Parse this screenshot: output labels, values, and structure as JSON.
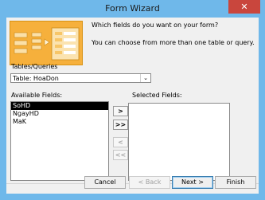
{
  "window": {
    "title": "Form Wizard",
    "close_label": "✕"
  },
  "banner": {
    "prompt": "Which fields do you want on your form?",
    "hint": "You can choose from more than one table or query."
  },
  "tables_queries": {
    "label": "Tables/Queries",
    "value": "Table: HoaDon",
    "arrow": "⌄"
  },
  "available_fields": {
    "label": "Available Fields:",
    "items": [
      "SoHD",
      "NgayHD",
      "MaK"
    ],
    "selected_index": 0
  },
  "selected_fields": {
    "label": "Selected Fields:",
    "items": []
  },
  "move_buttons": {
    "add_one": ">",
    "add_all": ">>",
    "remove_one": "<",
    "remove_all": "<<"
  },
  "buttons": {
    "cancel": "Cancel",
    "back": "< Back",
    "next": "Next >",
    "finish": "Finish"
  }
}
